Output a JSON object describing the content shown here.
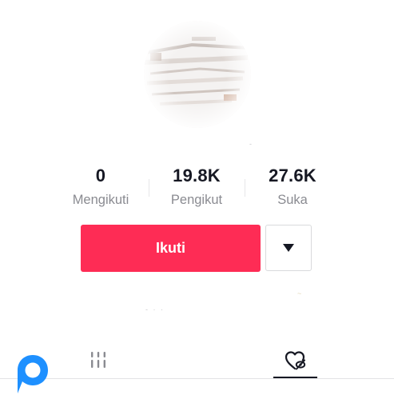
{
  "profile": {
    "stats": [
      {
        "value": "0",
        "label": "Mengikuti"
      },
      {
        "value": "19.8K",
        "label": "Pengikut"
      },
      {
        "value": "27.6K",
        "label": "Suka"
      }
    ],
    "follow_button_label": "Ikuti",
    "more_button_icon": "caret-down-icon"
  },
  "tabs": [
    {
      "icon": "videos-grid-icon",
      "selected": false
    },
    {
      "icon": "liked-heart-icon",
      "selected": true
    }
  ],
  "colors": {
    "accent": "#fe2c55",
    "text_primary": "#161823",
    "text_secondary": "#8a8b91",
    "watermark": "#1e90ff"
  }
}
